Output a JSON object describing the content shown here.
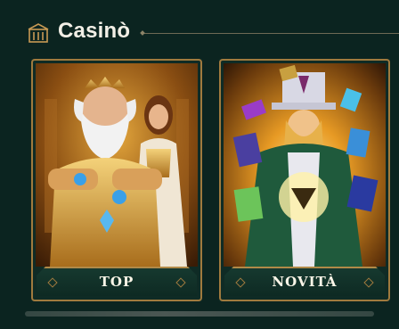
{
  "section": {
    "title": "Casinò",
    "icon": "casino-building-icon"
  },
  "cards": [
    {
      "label": "TOP",
      "art": "zeus-and-goddess-game-art"
    },
    {
      "label": "NOVITÀ",
      "art": "wizard-with-cards-game-art"
    }
  ],
  "colors": {
    "background": "#0b2420",
    "frame_gold": "#a07a3e",
    "plate": "#16392f",
    "text": "#f2efe6"
  }
}
